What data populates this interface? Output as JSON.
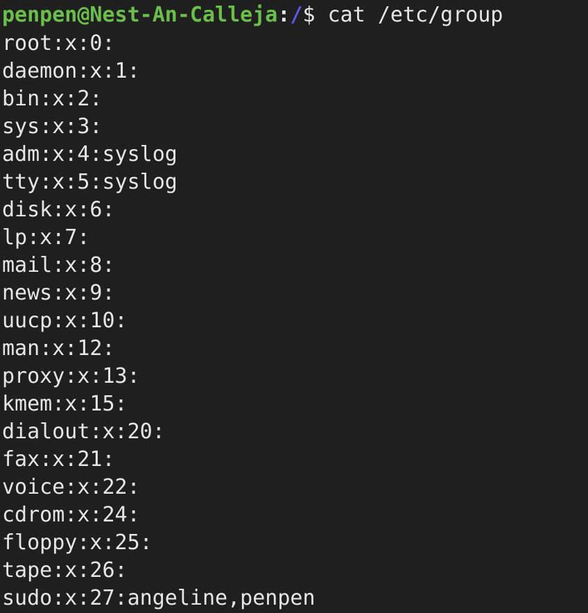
{
  "prompt": {
    "user_host": "penpen@Nest-An-Calleja",
    "separator": ":",
    "cwd": "/",
    "symbol": "$",
    "command": " cat /etc/group"
  },
  "output_lines": [
    "root:x:0:",
    "daemon:x:1:",
    "bin:x:2:",
    "sys:x:3:",
    "adm:x:4:syslog",
    "tty:x:5:syslog",
    "disk:x:6:",
    "lp:x:7:",
    "mail:x:8:",
    "news:x:9:",
    "uucp:x:10:",
    "man:x:12:",
    "proxy:x:13:",
    "kmem:x:15:",
    "dialout:x:20:",
    "fax:x:21:",
    "voice:x:22:",
    "cdrom:x:24:",
    "floppy:x:25:",
    "tape:x:26:",
    "sudo:x:27:angeline,penpen"
  ],
  "colors": {
    "background": "#1f1f1f",
    "text": "#e6e6e6",
    "user_host": "#6abf4b",
    "cwd": "#5b57e8"
  }
}
